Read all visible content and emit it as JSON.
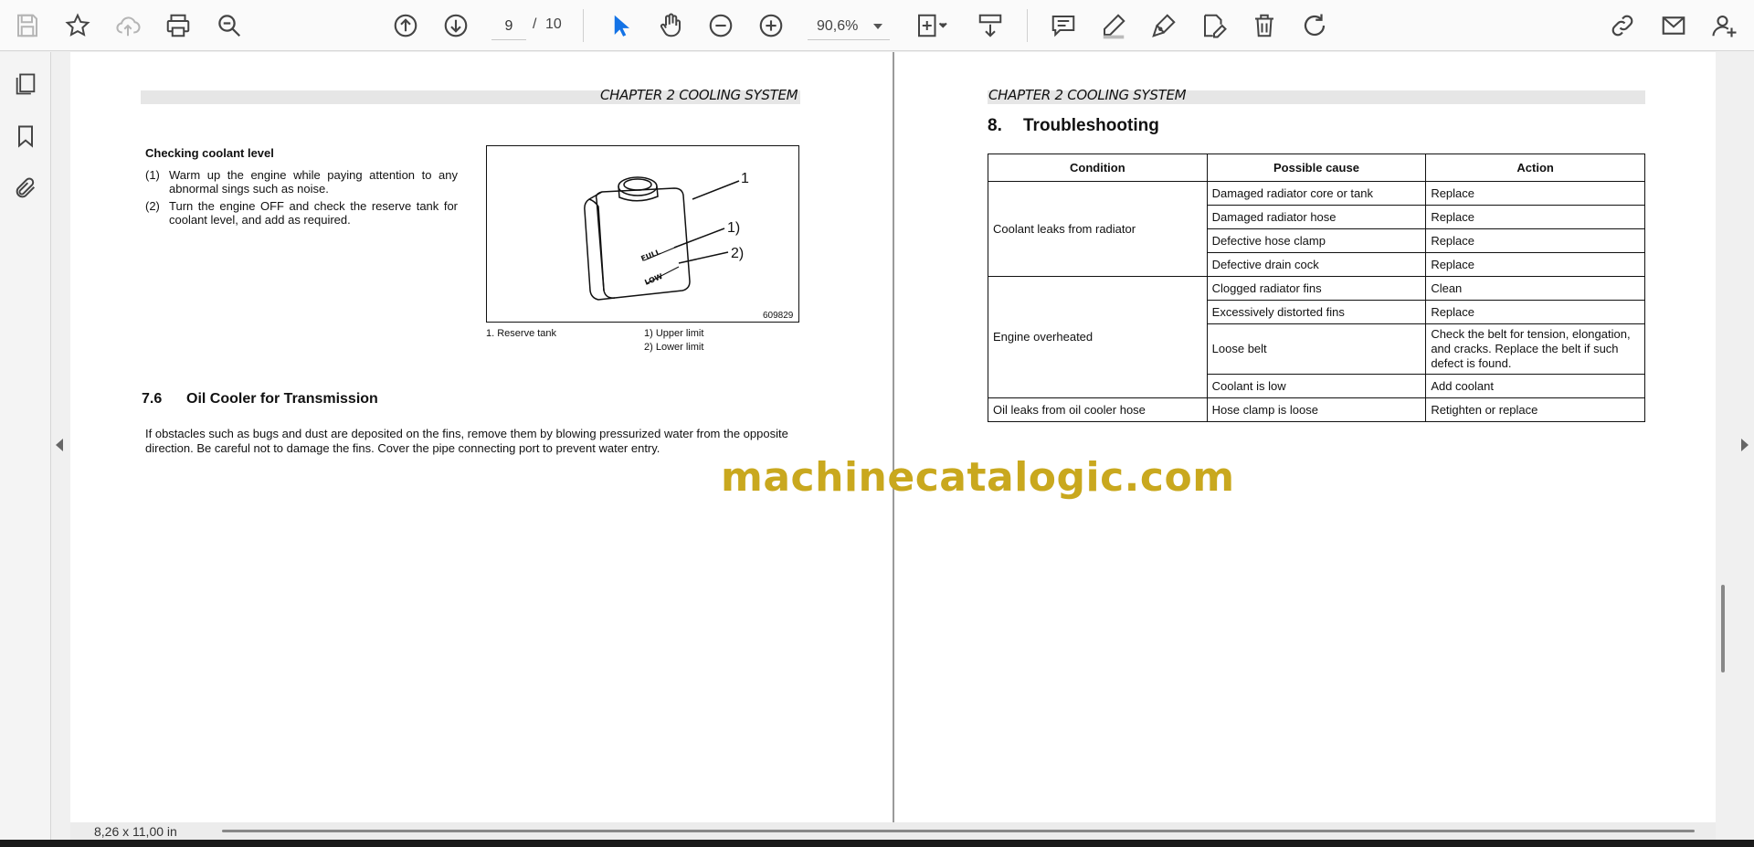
{
  "toolbar": {
    "current_page": "9",
    "page_separator": "/",
    "total_pages": "10",
    "zoom": "90,6%",
    "icons": [
      "save-icon",
      "star-icon",
      "upload-cloud-icon",
      "print-icon",
      "zoom-search-icon",
      "page-up-icon",
      "page-down-icon",
      "select-pointer-icon",
      "hand-icon",
      "zoom-out-icon",
      "zoom-in-icon",
      "fit-page-icon",
      "scroll-mode-icon",
      "comment-icon",
      "highlight-pen-icon",
      "draw-icon",
      "edit-icon",
      "delete-icon",
      "rotate-icon",
      "link-icon",
      "mail-icon",
      "add-user-icon"
    ],
    "accent_color": "#1473e6"
  },
  "sidebar": {
    "icons": [
      "pages-icon",
      "bookmark-icon",
      "attachment-icon"
    ]
  },
  "left_page": {
    "chapter": "CHAPTER 2 COOLING SYSTEM",
    "checking_title": "Checking coolant level",
    "steps": [
      {
        "num": "(1)",
        "text": "Warm up the engine while paying attention to any abnormal sings such as noise."
      },
      {
        "num": "(2)",
        "text": "Turn the engine OFF and check the reserve tank for coolant level, and add as required."
      }
    ],
    "figure": {
      "callout_1": "1",
      "callout_upper": "1)",
      "callout_lower": "2)",
      "label_full": "FULL",
      "label_low": "LOW",
      "figure_id": "609829"
    },
    "caption_left": "1.  Reserve tank",
    "caption_right_1": "1) Upper limit",
    "caption_right_2": "2) Lower limit",
    "section_num": "7.6",
    "section_title": "Oil Cooler for Transmission",
    "section_text": "If obstacles such as bugs and dust are deposited on the fins, remove them by blowing pressurized water from the opposite direction. Be careful not to damage the fins. Cover the pipe connecting port to prevent water entry."
  },
  "right_page": {
    "chapter": "CHAPTER 2 COOLING SYSTEM",
    "section_num": "8.",
    "section_title": "Troubleshooting",
    "table": {
      "headers": [
        "Condition",
        "Possible cause",
        "Action"
      ],
      "groups": [
        {
          "condition": "Coolant leaks from radiator",
          "rows": [
            {
              "cause": "Damaged radiator core or tank",
              "action": "Replace"
            },
            {
              "cause": "Damaged radiator hose",
              "action": "Replace"
            },
            {
              "cause": "Defective hose clamp",
              "action": "Replace"
            },
            {
              "cause": "Defective drain cock",
              "action": "Replace"
            }
          ]
        },
        {
          "condition": "Engine overheated",
          "rows": [
            {
              "cause": "Clogged radiator fins",
              "action": "Clean"
            },
            {
              "cause": "Excessively distorted fins",
              "action": "Replace"
            },
            {
              "cause": "Loose belt",
              "action": "Check the belt for tension, elongation, and cracks. Replace the belt if such defect is found."
            },
            {
              "cause": "Coolant is low",
              "action": "Add coolant"
            }
          ]
        },
        {
          "condition": "Oil leaks from oil cooler hose",
          "rows": [
            {
              "cause": "Hose clamp is loose",
              "action": "Retighten or replace"
            }
          ]
        }
      ]
    }
  },
  "watermark": "machinecatalogic.com",
  "status": {
    "page_size": "8,26 x 11,00 in"
  }
}
